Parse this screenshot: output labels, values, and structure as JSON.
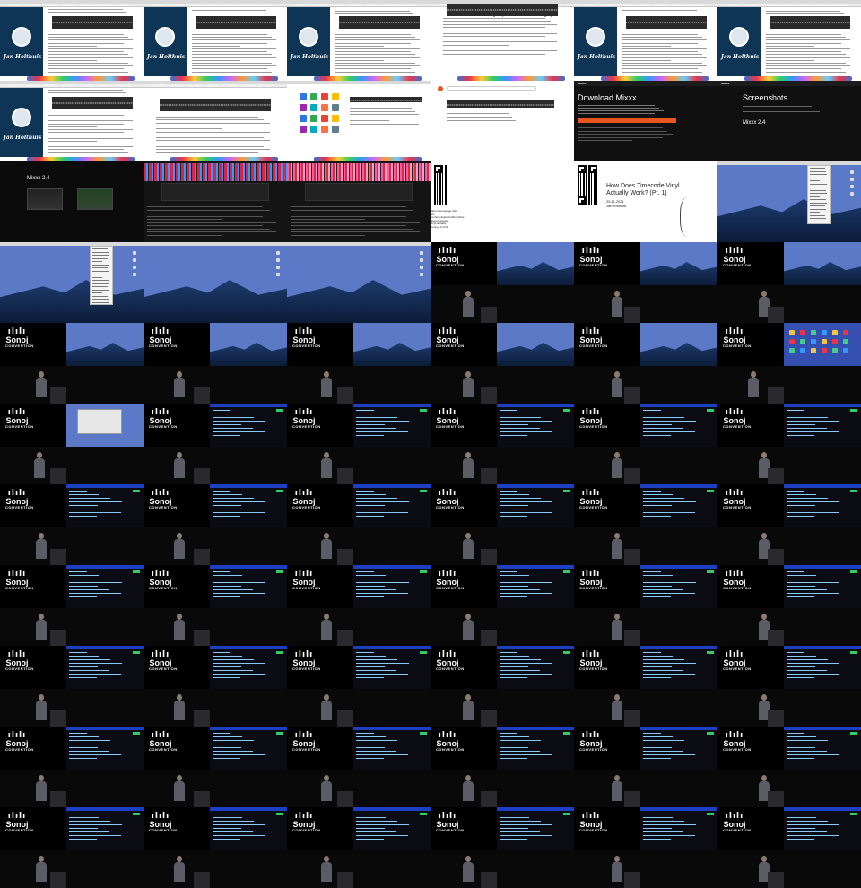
{
  "sheet": {
    "title": "",
    "columns": 6,
    "rows": 11
  },
  "blog": {
    "author_name": "Jan Holthuis",
    "heading_analog": "Getting the position out of the analog signal"
  },
  "mixxx_site": {
    "brand": "MIXXX",
    "download_title": "Download Mixxx",
    "screenshots_title": "Screenshots",
    "version_label": "Mixxx 2.4",
    "nav_items": [
      "DOWNLOAD",
      "FEATURES",
      "SCREENSHOTS",
      "SUPPORT",
      "NEWS",
      "GET INVOLVED"
    ]
  },
  "title_slide": {
    "title_line1": "How Does Timecode Vinyl",
    "title_line2": "Actually Work? (Pt. 1)",
    "date": "25.11.2021",
    "author": "Jan Holthuis",
    "link_text": "https://homepage.ruhr-uni-bochum.de/jan.holthuis/how-does-timecode-vinyl-actually-work-pt-1.html"
  },
  "venue": {
    "logo_bars": "ılılı",
    "logo_word": "Sonoj",
    "logo_sub": "CONVENTION"
  },
  "palette": {
    "blog_sidebar": "#0f3556",
    "slide_bg": "#0d0d0d",
    "desktop_sky": "#5c79c8",
    "terminal_bg": "#0b0b14",
    "accent_orange": "#e8561f"
  }
}
